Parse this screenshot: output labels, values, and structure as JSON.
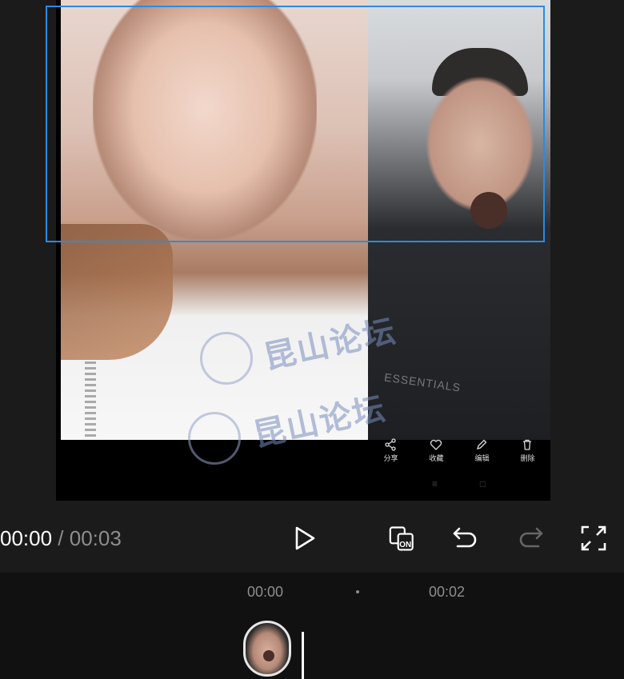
{
  "preview": {
    "watermark_text": "昆山论坛",
    "shirt_text": "ESSENTIALS",
    "actions": [
      {
        "label": "分享",
        "icon": "share-icon"
      },
      {
        "label": "收藏",
        "icon": "heart-icon"
      },
      {
        "label": "编辑",
        "icon": "pencil-icon"
      },
      {
        "label": "删除",
        "icon": "trash-icon"
      }
    ],
    "nav": {
      "menu": "≡",
      "home": "□"
    }
  },
  "controls": {
    "current_time": "00:00",
    "separator": " / ",
    "total_time": "00:03",
    "icons": [
      "play-icon",
      "original-sound-toggle-icon",
      "undo-icon",
      "redo-icon",
      "fullscreen-icon"
    ],
    "sound_badge": "ON"
  },
  "timeline": {
    "tick_0": "00:00",
    "tick_2": "00:02"
  },
  "colors": {
    "selection": "#2c8be0",
    "background": "#1b1b1b",
    "timeline_bg": "#111111",
    "muted_text": "#8d8d8d"
  }
}
